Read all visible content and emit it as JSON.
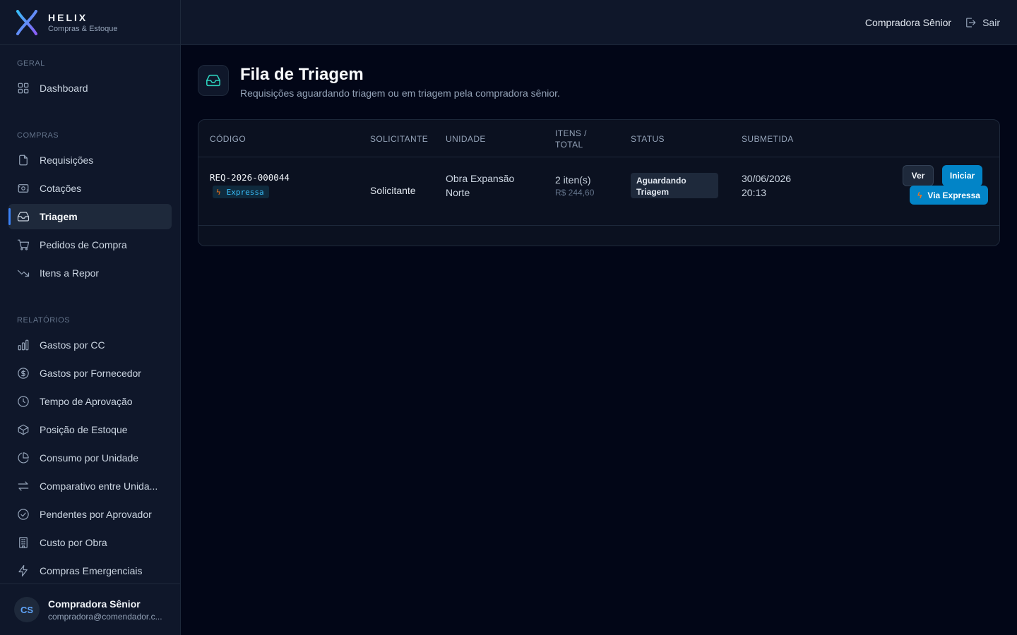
{
  "brand": {
    "name": "HELIX",
    "subtitle": "Compras & Estoque"
  },
  "colors": {
    "accent": "#3b82f6",
    "primary_button": "#0284c7",
    "express_orange": "#f97316",
    "teal_icon": "#2dd4bf",
    "background": "#020617",
    "sidebar": "#0f172a"
  },
  "sidebar": {
    "sections": [
      {
        "label": "GERAL",
        "items": [
          {
            "label": "Dashboard",
            "icon": "grid-icon"
          }
        ]
      },
      {
        "label": "COMPRAS",
        "items": [
          {
            "label": "Requisições",
            "icon": "file-icon"
          },
          {
            "label": "Cotações",
            "icon": "quote-icon"
          },
          {
            "label": "Triagem",
            "icon": "inbox-icon",
            "active": true
          },
          {
            "label": "Pedidos de Compra",
            "icon": "cart-icon"
          },
          {
            "label": "Itens a Repor",
            "icon": "trending-down-icon"
          }
        ]
      },
      {
        "label": "RELATÓRIOS",
        "items": [
          {
            "label": "Gastos por CC",
            "icon": "bar-chart-icon"
          },
          {
            "label": "Gastos por Fornecedor",
            "icon": "dollar-circle-icon"
          },
          {
            "label": "Tempo de Aprovação",
            "icon": "clock-icon"
          },
          {
            "label": "Posição de Estoque",
            "icon": "box-icon"
          },
          {
            "label": "Consumo por Unidade",
            "icon": "pie-chart-icon"
          },
          {
            "label": "Comparativo entre Unida...",
            "icon": "arrows-icon"
          },
          {
            "label": "Pendentes por Aprovador",
            "icon": "check-circle-icon"
          },
          {
            "label": "Custo por Obra",
            "icon": "building-icon"
          },
          {
            "label": "Compras Emergenciais",
            "icon": "zap-icon"
          }
        ]
      }
    ]
  },
  "user": {
    "initials": "CS",
    "name": "Compradora Sênior",
    "email": "compradora@comendador.c..."
  },
  "topbar": {
    "user_name": "Compradora Sênior",
    "logout_label": "Sair"
  },
  "page": {
    "title": "Fila de Triagem",
    "subtitle": "Requisições aguardando triagem ou em triagem pela compradora sênior."
  },
  "table": {
    "columns": {
      "code": "CÓDIGO",
      "requester": "SOLICITANTE",
      "unit": "UNIDADE",
      "items_line1": "ITENS /",
      "items_line2": "TOTAL",
      "status": "STATUS",
      "submitted": "SUBMETIDA"
    },
    "rows": [
      {
        "code": "REQ-2026-000044",
        "express_badge": "Expressa",
        "requester": "Solicitante",
        "unit_line1": "Obra Expansão",
        "unit_line2": "Norte",
        "items": "2 iten(s)",
        "total": "R$ 244,60",
        "status_line1": "Aguardando",
        "status_line2": "Triagem",
        "date": "30/06/2026",
        "time": "20:13",
        "btn_view": "Ver",
        "btn_start": "Iniciar",
        "btn_express": "Via Expressa"
      }
    ]
  }
}
